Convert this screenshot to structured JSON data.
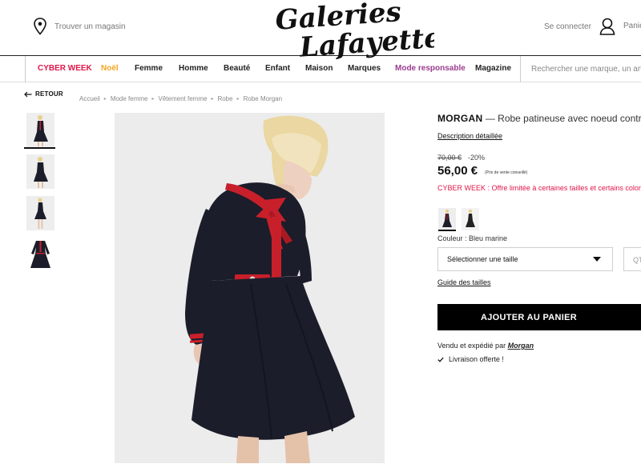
{
  "header": {
    "store_label": "Trouver un magasin",
    "logo_text": "Galeries Lafayette",
    "account_label": "Se connecter",
    "cart_label": "Panier"
  },
  "nav": {
    "items": [
      {
        "label": "CYBER WEEK",
        "color": "#e0164a"
      },
      {
        "label": "Noël",
        "color": "#f5a623"
      },
      {
        "label": "Femme",
        "color": "#222222"
      },
      {
        "label": "Homme",
        "color": "#222222"
      },
      {
        "label": "Beauté",
        "color": "#222222"
      },
      {
        "label": "Enfant",
        "color": "#222222"
      },
      {
        "label": "Maison",
        "color": "#222222"
      },
      {
        "label": "Marques",
        "color": "#222222"
      },
      {
        "label": "Mode responsable",
        "color": "#9b3c8f"
      },
      {
        "label": "Magazine",
        "color": "#222222"
      }
    ],
    "search_placeholder": "Rechercher une marque, un article"
  },
  "breadcrumb": {
    "back_label": "RETOUR",
    "items": [
      "Accueil",
      "Mode femme",
      "Vêtement femme",
      "Robe",
      "Robe Morgan"
    ]
  },
  "gallery": {
    "thumbnails": [
      "thumbnail-front",
      "thumbnail-back",
      "thumbnail-full",
      "thumbnail-flat"
    ],
    "active_index": 0
  },
  "product": {
    "brand": "MORGAN",
    "name": "— Robe patineuse avec noeud contrasta",
    "description_link": "Description détaillée",
    "old_price": "70,00 €",
    "discount": "-20%",
    "price": "56,00 €",
    "price_note": "(Prix de vente conseillé)",
    "promo": "CYBER WEEK : Offre limitée à certaines tailles et certains coloris",
    "color_label": "Couleur : Bleu marine",
    "size_placeholder": "Sélectionner une taille",
    "qty_label": "QT",
    "size_guide": "Guide des tailles",
    "add_to_cart": "AJOUTER AU PANIER",
    "sold_by_prefix": "Vendu et expédié par",
    "seller": "Morgan",
    "delivery": "Livraison offerte !"
  },
  "colors": {
    "accent_red": "#e0164a",
    "dress_navy": "#1b1d2a",
    "dress_red": "#c8202b"
  }
}
